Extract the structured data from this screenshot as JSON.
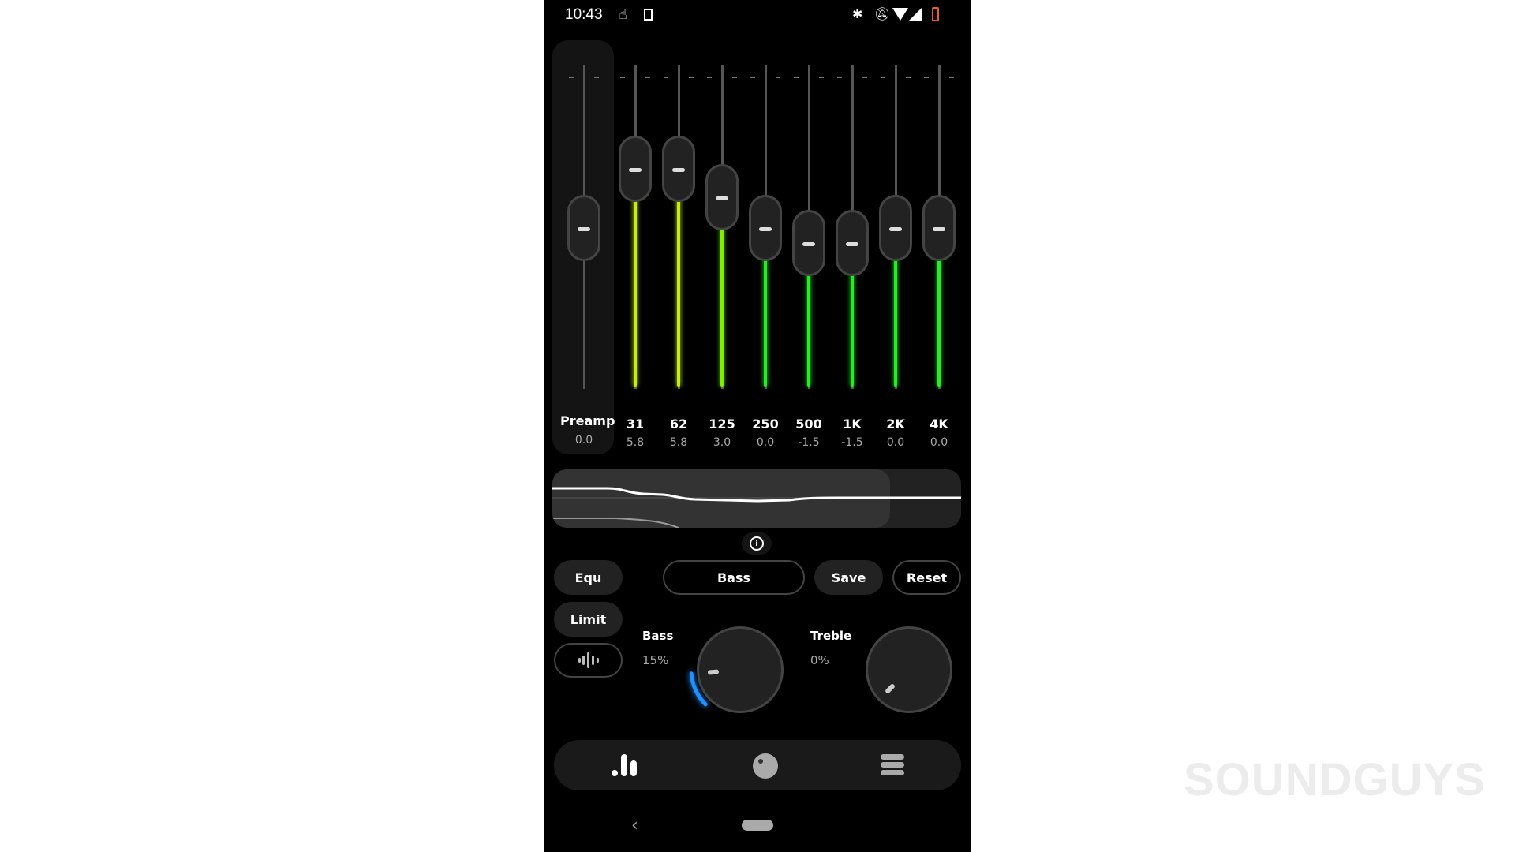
{
  "status_bar": {
    "time": "10:43",
    "icons": [
      "touch-icon",
      "sim-icon",
      "bluetooth-icon",
      "bell-off-icon",
      "wifi-icon",
      "signal-icon",
      "battery-low-icon"
    ]
  },
  "equalizer": {
    "range_db": [
      -15,
      15
    ],
    "preamp": {
      "label": "Preamp",
      "value": "0.0",
      "db": 0
    },
    "bands": [
      {
        "label": "31",
        "value": "5.8",
        "db": 5.8,
        "color": "#c6f000"
      },
      {
        "label": "62",
        "value": "5.8",
        "db": 5.8,
        "color": "#c6f000"
      },
      {
        "label": "125",
        "value": "3.0",
        "db": 3.0,
        "color": "#7cf000"
      },
      {
        "label": "250",
        "value": "0.0",
        "db": 0,
        "color": "#22ee22"
      },
      {
        "label": "500",
        "value": "-1.5",
        "db": -1.5,
        "color": "#22ee22"
      },
      {
        "label": "1K",
        "value": "-1.5",
        "db": -1.5,
        "color": "#22ee22"
      },
      {
        "label": "2K",
        "value": "0.0",
        "db": 0,
        "color": "#22ee22"
      },
      {
        "label": "4K",
        "value": "0.0",
        "db": 0,
        "color": "#22ee22"
      }
    ]
  },
  "controls": {
    "equ": "Equ",
    "preset": "Bass",
    "save": "Save",
    "reset": "Reset",
    "limit": "Limit"
  },
  "knobs": {
    "bass": {
      "label": "Bass",
      "value": "15%",
      "percent": 15,
      "accent": "#1e90ff"
    },
    "treble": {
      "label": "Treble",
      "value": "0%",
      "percent": 0
    }
  },
  "bottom_nav": [
    "equalizer-icon",
    "knob-icon",
    "menu-icon"
  ],
  "watermark": "SOUNDGUYS"
}
